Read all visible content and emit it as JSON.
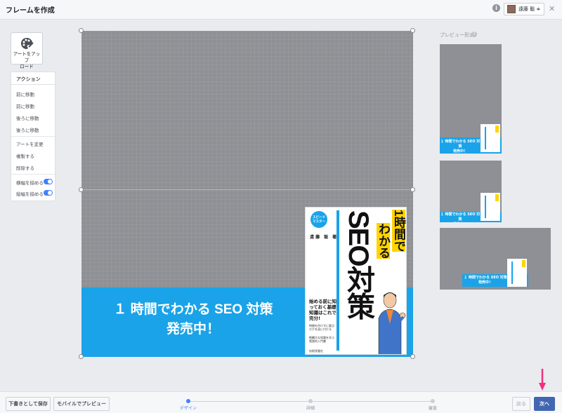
{
  "header": {
    "title": "フレームを作成",
    "account_name": "遠藤 聡 ≑",
    "info_icon": "info-icon",
    "close_icon": "close-icon"
  },
  "tools": {
    "upload_label_1": "アートをアップ",
    "upload_label_2": "ロード",
    "actions_header": "アクション",
    "items": [
      {
        "label": "前に移動"
      },
      {
        "label": "前に移動"
      },
      {
        "label": "後ろに移動"
      },
      {
        "label": "後ろに移動"
      },
      {
        "label": "アートを変更"
      },
      {
        "label": "複製する"
      },
      {
        "label": "削除する"
      },
      {
        "label": "横幅を揃める",
        "toggle": true
      },
      {
        "label": "縦幅を揃める",
        "toggle": true
      }
    ]
  },
  "canvas": {
    "banner_line_1": "１ 時間でわかる SEO 対策",
    "banner_line_2": "発売中！",
    "book": {
      "badge_1": "スピード",
      "badge_2": "マスター",
      "author": "遠 藤　聡　著",
      "title_a": "1時間で",
      "title_b": "わかる",
      "title_c": "SEO対策",
      "blurb": "始める前に知っておく基礎知識はこれで完分!",
      "small_1": "時間を作けずに要点だけを身に付ける",
      "small_2": "断續方な知識を学ぶ実践的入門書",
      "publisher": "技術評論社"
    }
  },
  "preview": {
    "label": "プレビュー形式",
    "thumb_banner_1": "１ 時間でわかる SEO 対策",
    "thumb_banner_2": "発売中！"
  },
  "footer": {
    "save_draft": "下書きとして保存",
    "mobile_preview": "モバイルでプレビュー",
    "steps": [
      "デザイン",
      "詳細",
      "審査"
    ],
    "active_step": 0,
    "back": "戻る",
    "next": "次へ"
  },
  "colors": {
    "accent": "#4267b2",
    "banner": "#1aa3e8",
    "arrow": "#f0307e"
  }
}
